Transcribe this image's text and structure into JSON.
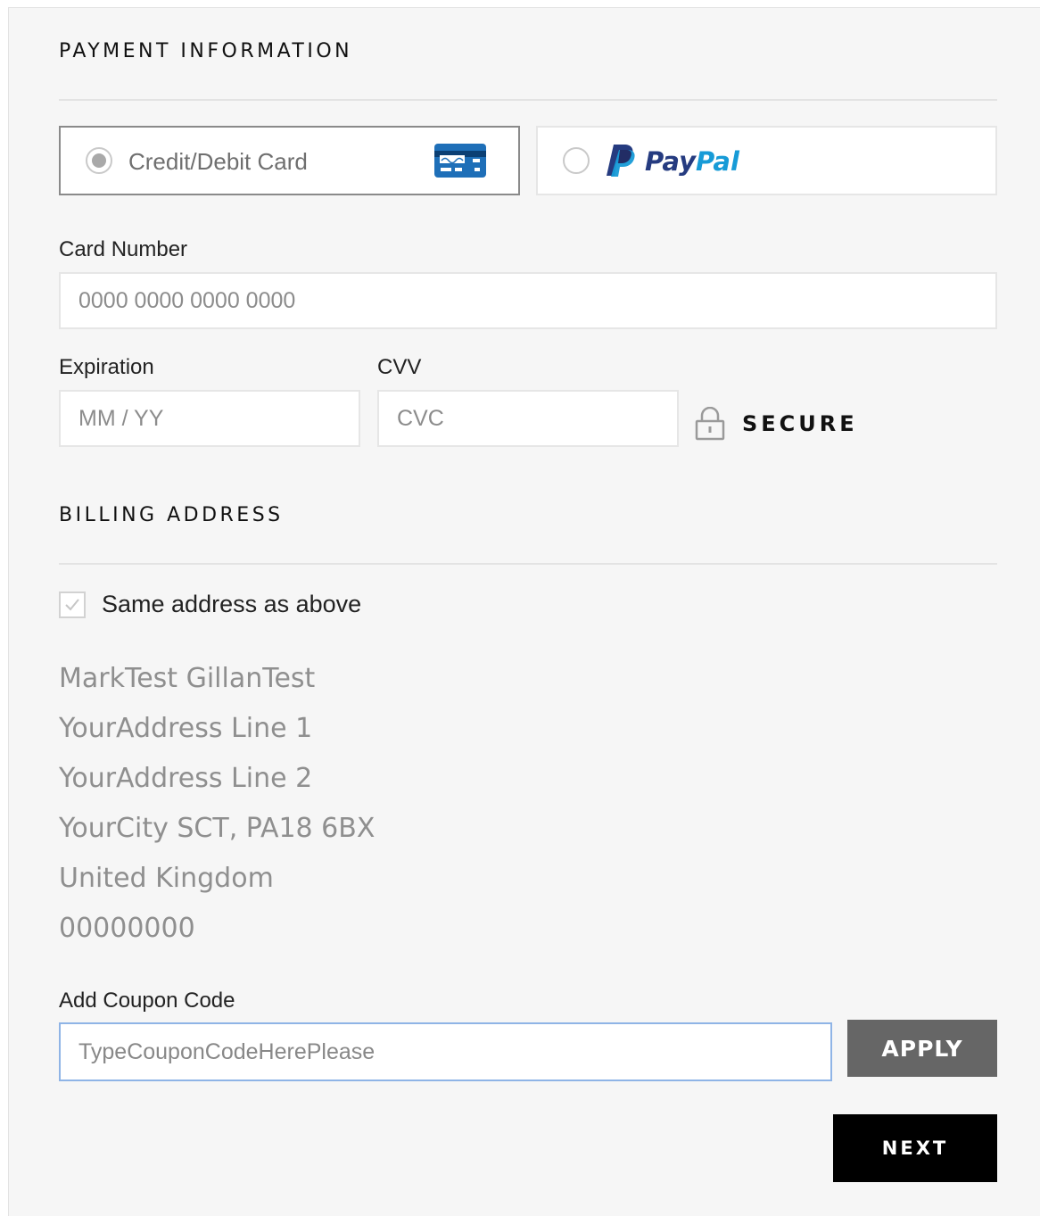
{
  "payment": {
    "title": "PAYMENT INFORMATION",
    "methods": [
      {
        "label": "Credit/Debit Card",
        "icon": "credit-card-icon",
        "selected": true
      },
      {
        "label": "PayPal",
        "logo_part1": "Pay",
        "logo_part2": "Pal",
        "icon": "paypal-logo",
        "selected": false
      }
    ],
    "card_number": {
      "label": "Card Number",
      "placeholder": "0000 0000 0000 0000"
    },
    "expiration": {
      "label": "Expiration",
      "placeholder": "MM / YY"
    },
    "cvv": {
      "label": "CVV",
      "placeholder": "CVC"
    },
    "secure": {
      "label": "SECURE",
      "icon": "lock-icon"
    }
  },
  "billing": {
    "title": "BILLING ADDRESS",
    "same_address": {
      "label": "Same address as above",
      "checked": true
    },
    "address_lines": [
      "MarkTest GillanTest",
      "YourAddress Line 1",
      "YourAddress Line 2",
      "YourCity SCT, PA18 6BX",
      "United Kingdom",
      "00000000"
    ]
  },
  "coupon": {
    "label": "Add Coupon Code",
    "value": "TypeCouponCodeHerePlease",
    "apply_label": "APPLY"
  },
  "next_label": "NEXT",
  "colors": {
    "panel_bg": "#f6f6f6",
    "paypal_dark": "#253b80",
    "paypal_light": "#179bd7",
    "apply_bg": "#666666",
    "next_bg": "#000000",
    "focus_border": "#8fb4e6"
  }
}
